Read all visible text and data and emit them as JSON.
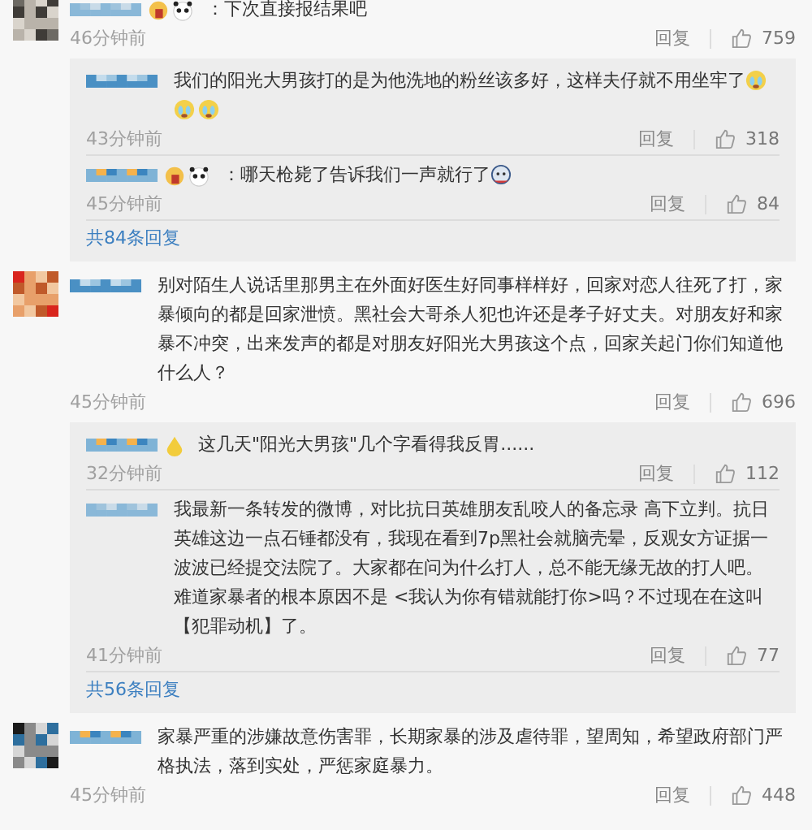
{
  "comments": [
    {
      "stickers_before": [
        {
          "kind": "badge"
        },
        {
          "kind": "panda"
        }
      ],
      "text": "：下次直接报结果吧",
      "time": "46分钟前",
      "reply_label": "回复",
      "likes": "759",
      "replies": [
        {
          "text": "我们的阳光大男孩打的是为他洗地的粉丝该多好，这样夫仔就不用坐牢了",
          "stickers_after": [
            {
              "kind": "crying"
            },
            {
              "kind": "crying"
            },
            {
              "kind": "crying"
            }
          ],
          "time": "43分钟前",
          "reply_label": "回复",
          "likes": "318"
        },
        {
          "stickers_before": [
            {
              "kind": "badge"
            },
            {
              "kind": "panda"
            }
          ],
          "text": "：哪天枪毙了告诉我们一声就行了",
          "stickers_after": [
            {
              "kind": "hat"
            }
          ],
          "time": "45分钟前",
          "reply_label": "回复",
          "likes": "84"
        }
      ],
      "more_replies": "共84条回复"
    },
    {
      "text": "别对陌生人说话里那男主在外面好医生好同事样样好，回家对恋人往死了打，家暴倾向的都是回家泄愤。黑社会大哥杀人犯也许还是孝子好丈夫。对朋友好和家暴不冲突，出来发声的都是对朋友好阳光大男孩这个点，回家关起门你们知道他什么人？",
      "time": "45分钟前",
      "reply_label": "回复",
      "likes": "696",
      "replies": [
        {
          "stickers_before": [
            {
              "kind": "drop"
            }
          ],
          "text": "这几天\"阳光大男孩\"几个字看得我反胃......",
          "time": "32分钟前",
          "reply_label": "回复",
          "likes": "112"
        },
        {
          "text": "我最新一条转发的微博，对比抗日英雄朋友乱咬人的备忘录 高下立判。抗日英雄这边一点石锤都没有，我现在看到7p黑社会就脑壳晕，反观女方证据一波波已经提交法院了。大家都在问为什么打人，总不能无缘无故的打人吧。难道家暴者的根本原因不是 <我认为你有错就能打你>吗？不过现在在这叫【犯罪动机】了。",
          "time": "41分钟前",
          "reply_label": "回复",
          "likes": "77"
        }
      ],
      "more_replies": "共56条回复"
    },
    {
      "text": "家暴严重的涉嫌故意伤害罪，长期家暴的涉及虐待罪，望周知，希望政府部门严格执法，落到实处，严惩家庭暴力。",
      "time": "45分钟前",
      "reply_label": "回复",
      "likes": "448"
    }
  ]
}
